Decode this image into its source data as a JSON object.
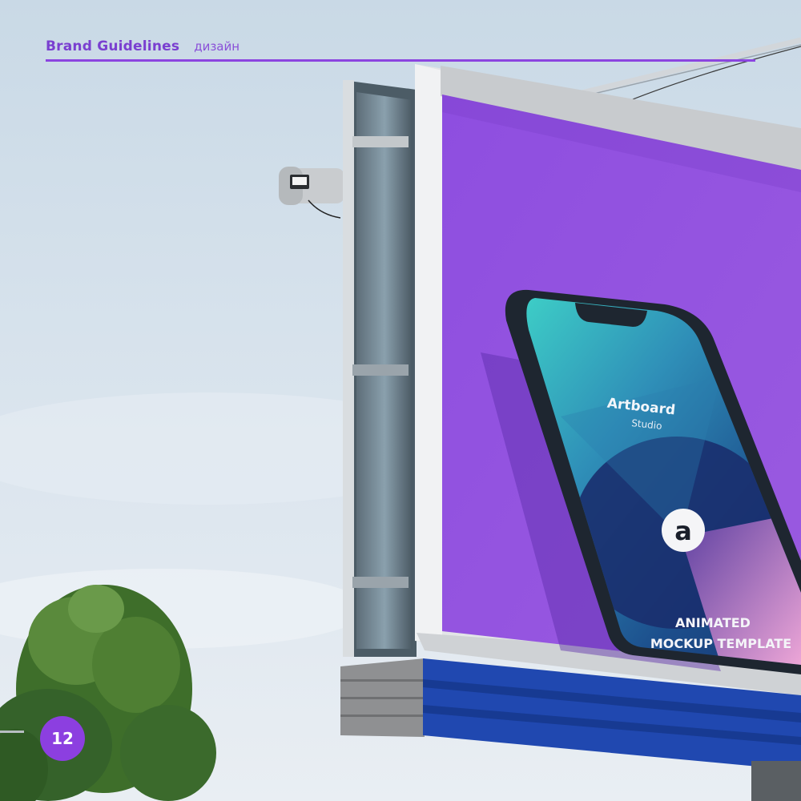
{
  "header": {
    "title": "Brand Guidelines",
    "subtitle": "дизайн"
  },
  "page_number": "12",
  "billboard_ad": {
    "brand_name": "Artboard",
    "brand_sub": "Studio",
    "logo_letter": "a",
    "line1": "ANIMATED",
    "line2": "MOCKUP TEMPLATE"
  },
  "colors": {
    "accent": "#8b45e0",
    "billboard_bg": "#8f4fdc",
    "sky": "#dce6ee"
  }
}
